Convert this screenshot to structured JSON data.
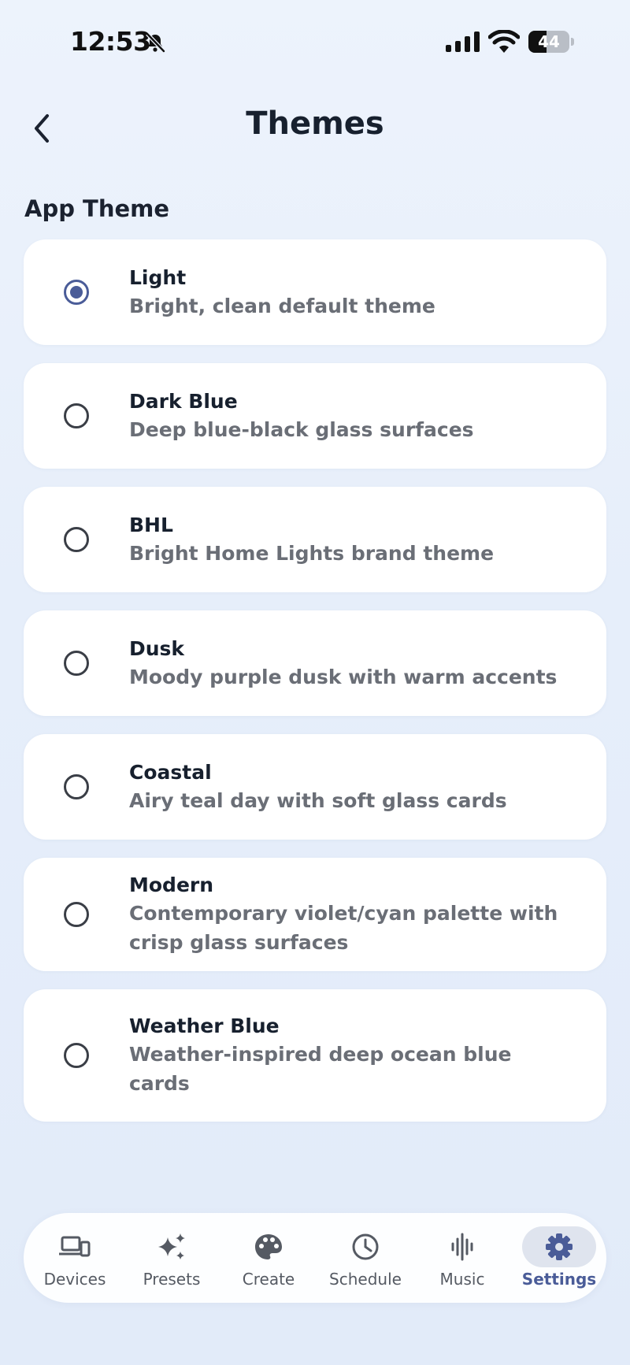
{
  "status_bar": {
    "time": "12:53",
    "battery": "44",
    "battery_level": 0.44,
    "icons": [
      "bell-slash-icon",
      "signal-icon",
      "wifi-icon",
      "battery-icon"
    ]
  },
  "header": {
    "title": "Themes",
    "back_icon": "chevron-left-icon"
  },
  "section": {
    "title": "App Theme"
  },
  "themes": [
    {
      "name": "Light",
      "description": "Bright, clean default theme",
      "selected": true
    },
    {
      "name": "Dark Blue",
      "description": "Deep blue-black glass surfaces",
      "selected": false
    },
    {
      "name": "BHL",
      "description": "Bright Home Lights brand theme",
      "selected": false
    },
    {
      "name": "Dusk",
      "description": "Moody purple dusk with warm accents",
      "selected": false
    },
    {
      "name": "Coastal",
      "description": "Airy teal day with soft glass cards",
      "selected": false
    },
    {
      "name": "Modern",
      "description": "Contemporary violet/cyan palette with crisp glass surfaces",
      "selected": false
    },
    {
      "name": "Weather Blue",
      "description": "Weather-inspired deep ocean blue cards",
      "selected": false
    }
  ],
  "tab_bar": {
    "tabs": [
      {
        "label": "Devices",
        "icon": "devices-icon",
        "active": false
      },
      {
        "label": "Presets",
        "icon": "sparkles-icon",
        "active": false
      },
      {
        "label": "Create",
        "icon": "palette-icon",
        "active": false
      },
      {
        "label": "Schedule",
        "icon": "clock-icon",
        "active": false
      },
      {
        "label": "Music",
        "icon": "waveform-icon",
        "active": false
      },
      {
        "label": "Settings",
        "icon": "gear-icon",
        "active": true
      }
    ]
  },
  "colors": {
    "accent": "#4a5c98",
    "background": "#e8eff9",
    "card": "#ffffff",
    "active_tab_pill": "#dfe4ee"
  }
}
